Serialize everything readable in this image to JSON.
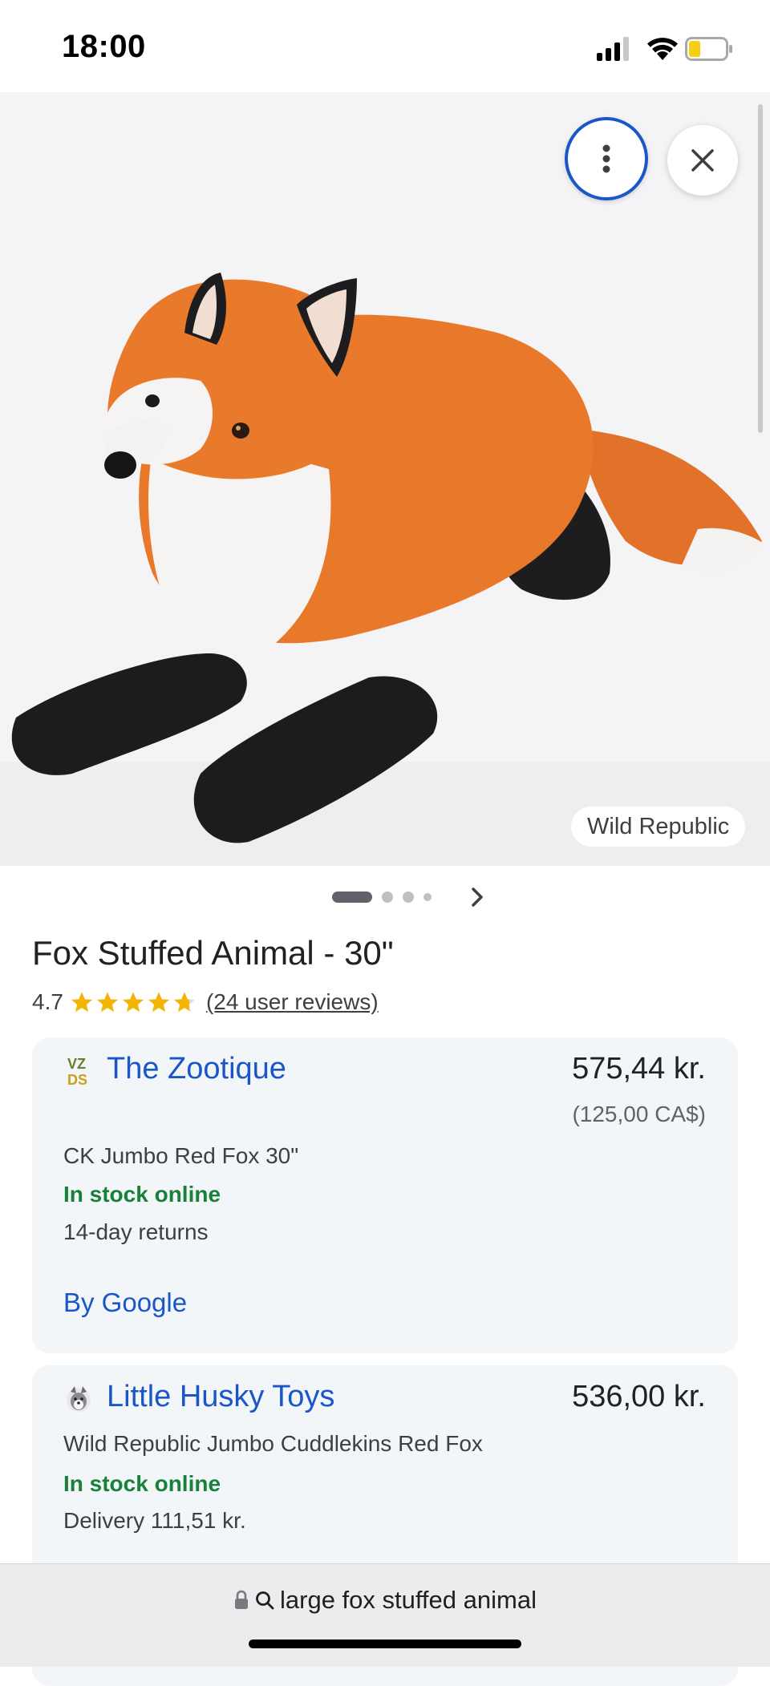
{
  "status_bar": {
    "time": "18:00"
  },
  "viewer": {
    "more_button": "more-vert-icon",
    "close_button": "close-icon",
    "source_label": "Wild Republic",
    "image_subject": "fox-plush-image",
    "carousel_count": 4,
    "carousel_active": 1
  },
  "product": {
    "title": "Fox Stuffed Animal - 30\"",
    "rating": "4.7",
    "stars": 4.7,
    "reviews_label": "(24 user reviews)"
  },
  "offers": [
    {
      "seller": "The Zootique",
      "logo": "VZ\nDS",
      "price": "575,44 kr.",
      "price_alt": "(125,00 CA$)",
      "description": "CK Jumbo Red Fox 30\"",
      "stock": "In stock online",
      "detail": "14-day returns",
      "by_google": "By Google"
    },
    {
      "seller": "Little Husky Toys",
      "price": "536,00 kr.",
      "description": "Wild Republic Jumbo Cuddlekins Red Fox",
      "stock": "In stock online",
      "detail": "Delivery 111,51 kr."
    }
  ],
  "address_bar": {
    "url_text": "large fox stuffed animal"
  },
  "colors": {
    "link_blue": "#1a56c8",
    "stock_green": "#188038",
    "star_gold": "#f5b400",
    "fox_orange": "#e8782a"
  }
}
